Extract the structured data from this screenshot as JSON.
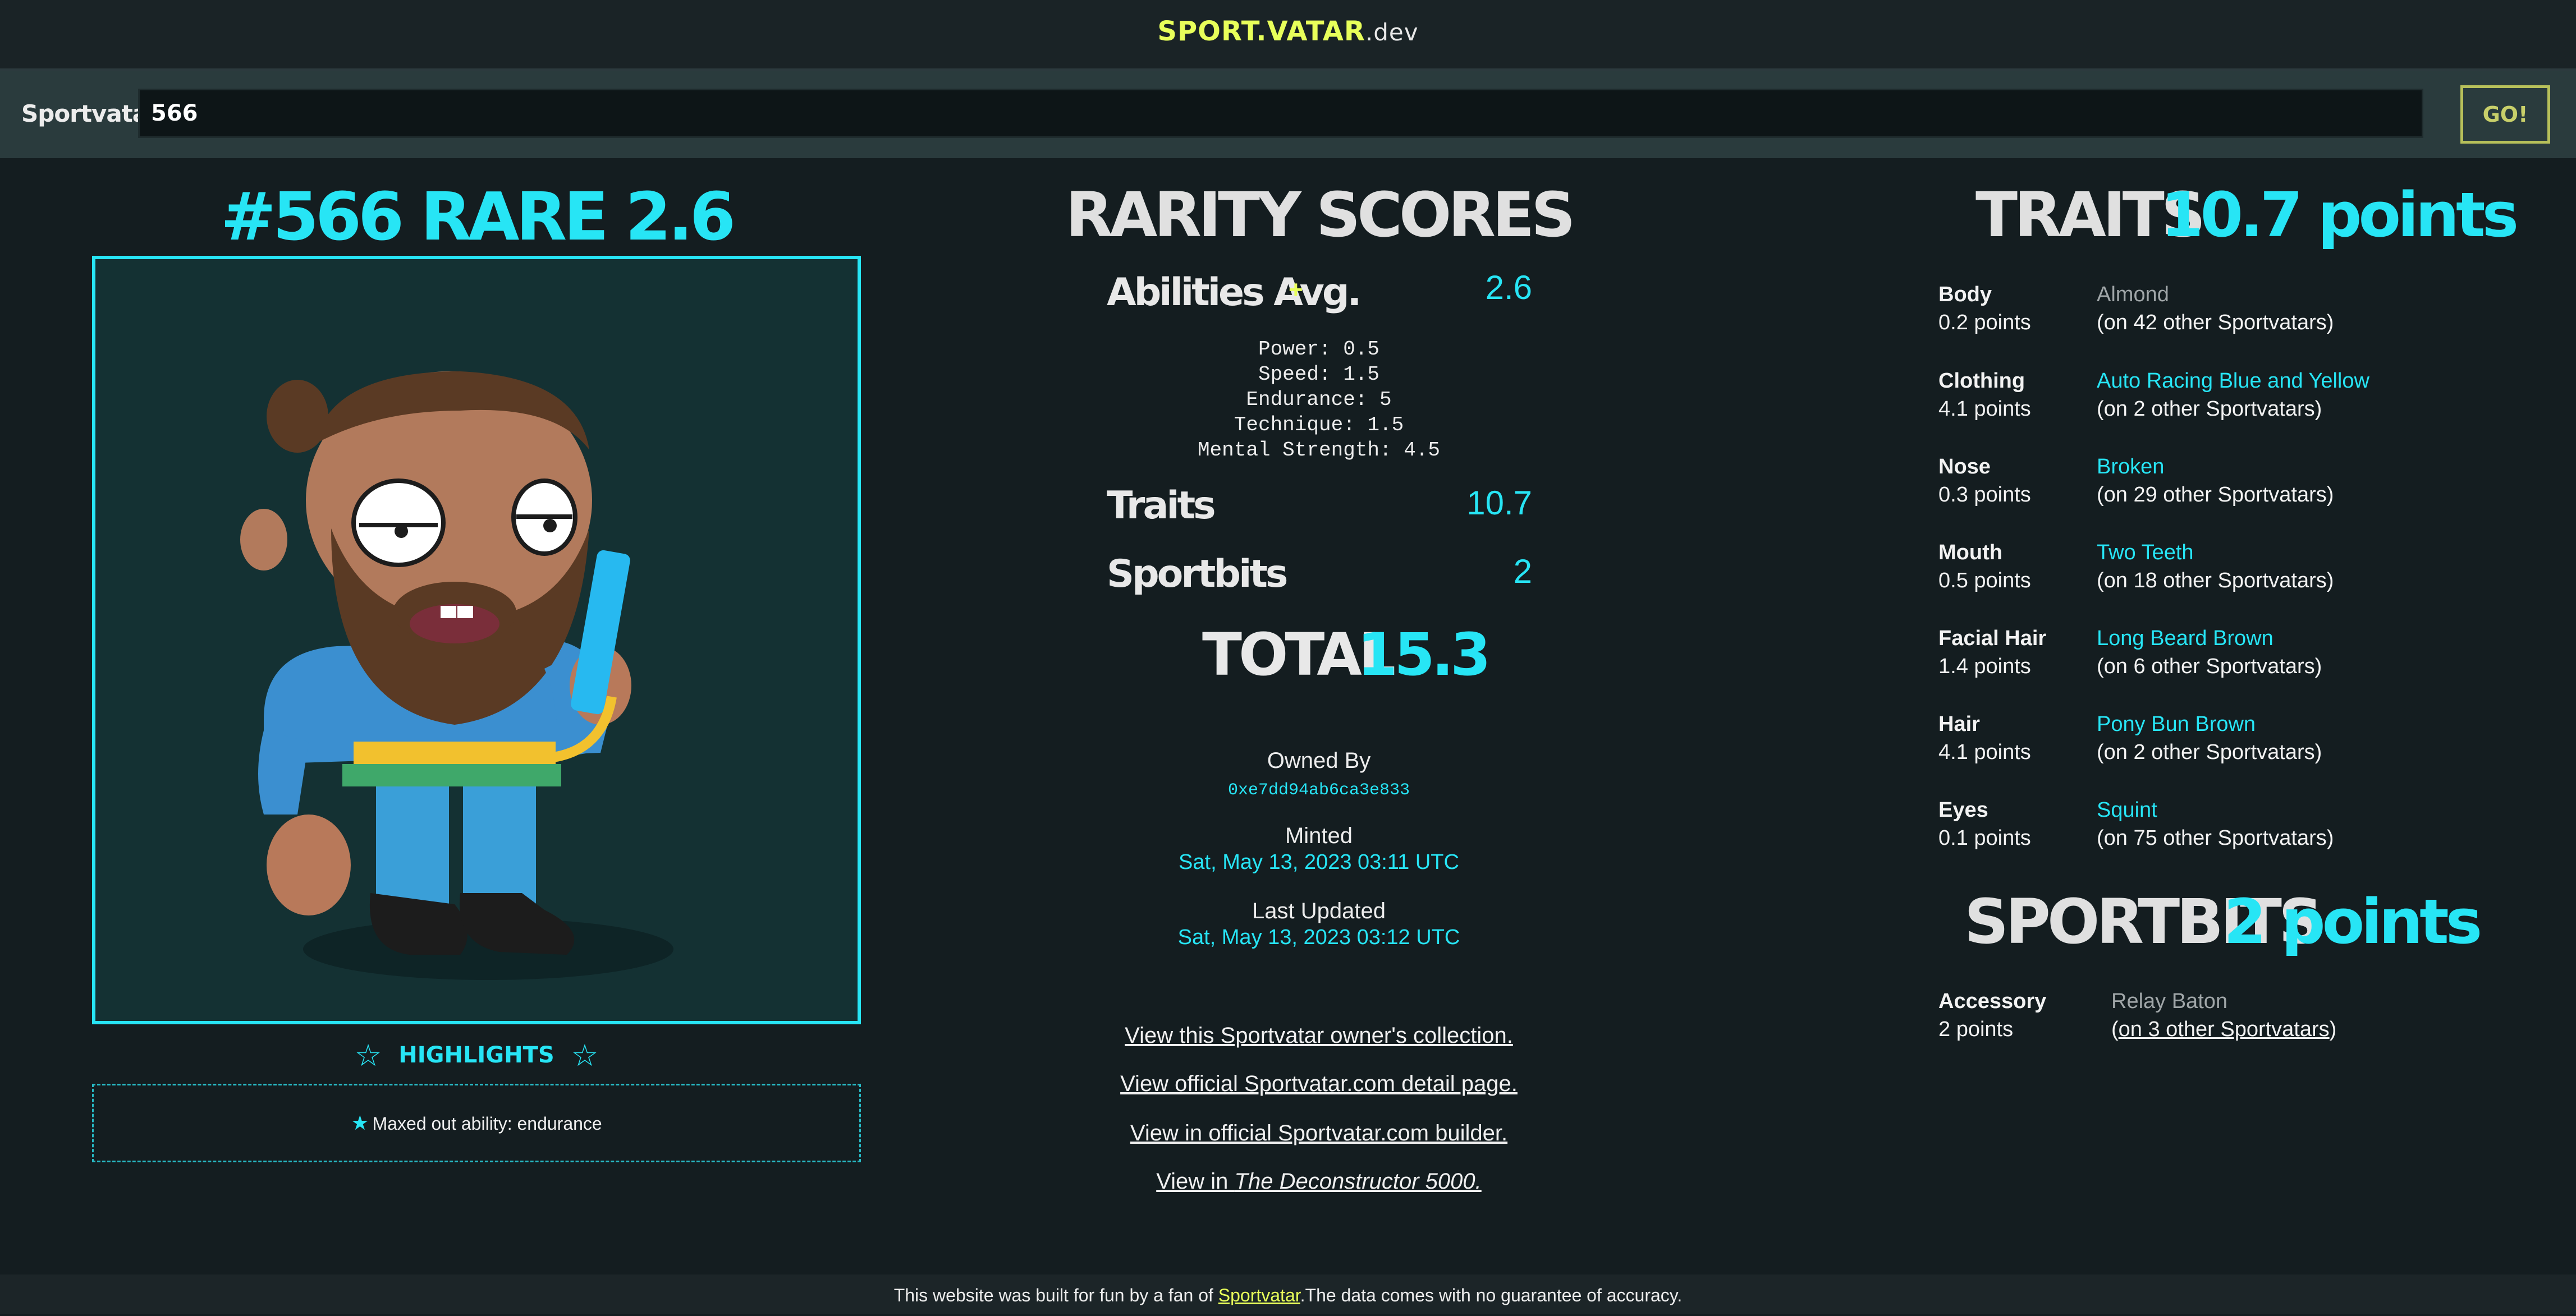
{
  "header": {
    "logo_main": "SPORT.VATAR",
    "logo_suffix": ".dev"
  },
  "search": {
    "label": "Sportvatar #",
    "value": "566",
    "button": "GO!"
  },
  "avatar": {
    "title": "#566 RARE 2.6",
    "highlights_label": "HIGHLIGHTS",
    "highlight_item": "Maxed out ability: endurance"
  },
  "rarity": {
    "title": "RARITY SCORES",
    "abilities_label": "Abilities Avg.",
    "abilities_plus": "+",
    "abilities_value": "2.6",
    "abilities": [
      "Power: 0.5",
      "Speed: 1.5",
      "Endurance: 5",
      "Technique: 1.5",
      "Mental Strength: 4.5"
    ],
    "traits_label": "Traits",
    "traits_value": "10.7",
    "sportbits_label": "Sportbits",
    "sportbits_value": "2",
    "total_label": "TOTAL",
    "total_value": "15.3"
  },
  "meta": {
    "owned_by_label": "Owned By",
    "owner_address": "0xe7dd94ab6ca3e833",
    "minted_label": "Minted",
    "minted_date": "Sat, May 13, 2023 03:11 UTC",
    "updated_label": "Last Updated",
    "updated_date": "Sat, May 13, 2023 03:12 UTC"
  },
  "links": {
    "collection": "View this Sportvatar owner's collection.",
    "detail": "View official Sportvatar.com detail page.",
    "builder": "View in official Sportvatar.com builder.",
    "deconstructor_prefix": "View in ",
    "deconstructor_title": "The Deconstructor 5000."
  },
  "traits": {
    "title": "TRAITS",
    "points": "10.7 points",
    "items": [
      {
        "name": "Body",
        "points": "0.2 points",
        "value": "Almond",
        "other": "(on 42 other Sportvatars)"
      },
      {
        "name": "Clothing",
        "points": "4.1 points",
        "value": "Auto Racing Blue and Yellow",
        "other": "(on 2 other Sportvatars)"
      },
      {
        "name": "Nose",
        "points": "0.3 points",
        "value": "Broken",
        "other": "(on 29 other Sportvatars)"
      },
      {
        "name": "Mouth",
        "points": "0.5 points",
        "value": "Two Teeth",
        "other": "(on 18 other Sportvatars)"
      },
      {
        "name": "Facial Hair",
        "points": "1.4 points",
        "value": "Long Beard Brown",
        "other": "(on 6 other Sportvatars)"
      },
      {
        "name": "Hair",
        "points": "4.1 points",
        "value": "Pony Bun Brown",
        "other": "(on 2 other Sportvatars)"
      },
      {
        "name": "Eyes",
        "points": "0.1 points",
        "value": "Squint",
        "other": "(on 75 other Sportvatars)"
      }
    ]
  },
  "sportbits": {
    "title": "SPORTBITS",
    "points": "2 points",
    "item_name": "Accessory",
    "item_points": "2 points",
    "item_value": "Relay Baton",
    "item_other_open": "(",
    "item_other_link": "on 3 other Sportvatars",
    "item_other_close": ")"
  },
  "footer": {
    "prefix": "This website was built for fun by a fan of ",
    "link": "Sportvatar",
    "suffix": ".The data comes with no guarantee of accuracy."
  },
  "colors": {
    "accent": "#27e5f5",
    "logo": "#e8ff5a",
    "background": "#141d20"
  }
}
